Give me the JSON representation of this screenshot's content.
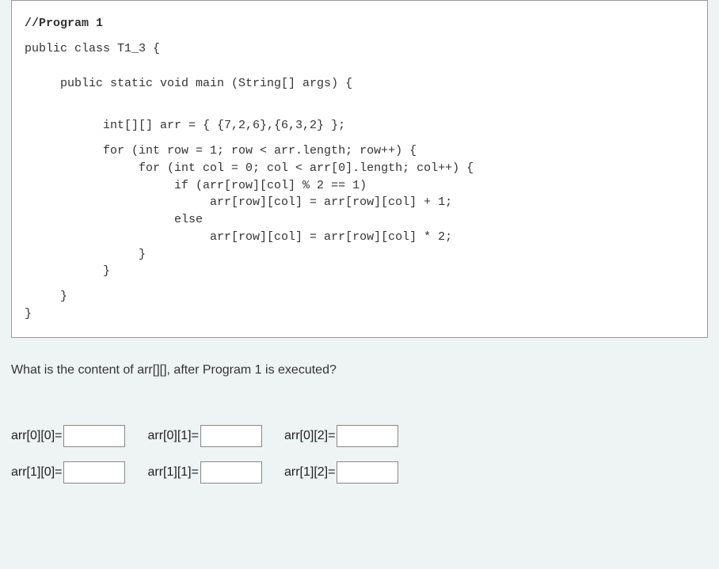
{
  "code": {
    "line1": "//Program 1",
    "line2": "public class T1_3 {",
    "line3": "     public static void main (String[] args) {",
    "line4": "           int[][] arr = { {7,2,6},{6,3,2} };",
    "line5": "           for (int row = 1; row < arr.length; row++) {",
    "line6": "                for (int col = 0; col < arr[0].length; col++) {",
    "line7": "                     if (arr[row][col] % 2 == 1)",
    "line8": "                          arr[row][col] = arr[row][col] + 1;",
    "line9": "                     else",
    "line10": "                          arr[row][col] = arr[row][col] * 2;",
    "line11": "                }",
    "line12": "           }",
    "line13": "     }",
    "line14": "}"
  },
  "question": "What is the content of arr[][], after Program 1 is executed?",
  "answers": {
    "row0": [
      {
        "label": "arr[0][0]=",
        "value": ""
      },
      {
        "label": "arr[0][1]=",
        "value": ""
      },
      {
        "label": "arr[0][2]=",
        "value": ""
      }
    ],
    "row1": [
      {
        "label": "arr[1][0]=",
        "value": ""
      },
      {
        "label": "arr[1][1]=",
        "value": ""
      },
      {
        "label": "arr[1][2]=",
        "value": ""
      }
    ]
  }
}
